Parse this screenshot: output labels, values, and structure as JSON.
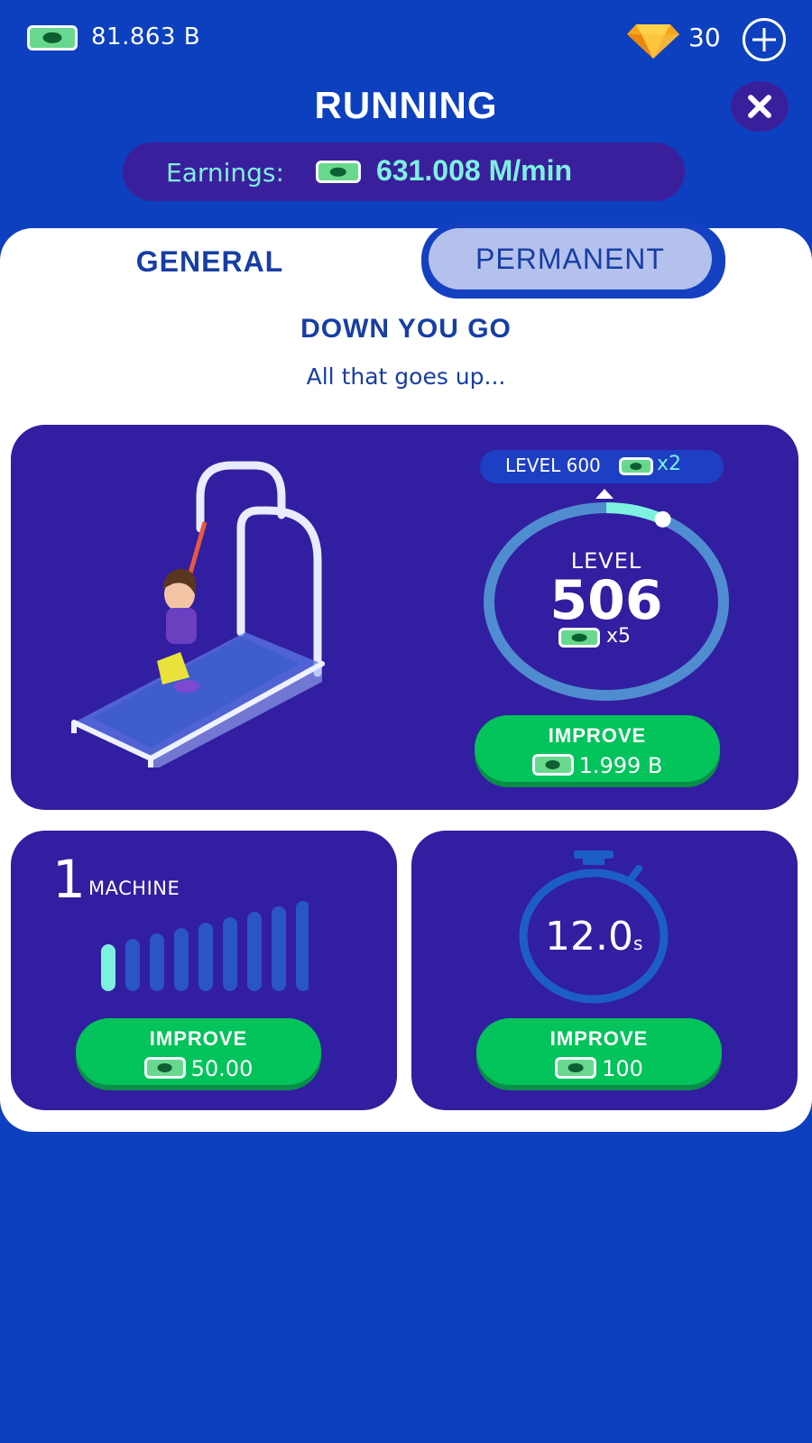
{
  "topbar": {
    "money": "81.863 B",
    "gems": "30",
    "money_icon": "cash-icon",
    "gem_icon": "diamond-icon",
    "plus_icon": "plus-icon"
  },
  "header": {
    "title": "RUNNING",
    "close_icon": "close-icon"
  },
  "earnings": {
    "label": "Earnings:",
    "value": "631.008 M/min"
  },
  "tabs": [
    {
      "label": "GENERAL",
      "active": true
    },
    {
      "label": "PERMANENT",
      "active": false
    }
  ],
  "upgrade": {
    "title": "DOWN YOU GO",
    "subtitle": "All that goes up..."
  },
  "level_card": {
    "next_milestone": "LEVEL 600",
    "next_multiplier": "x2",
    "level_label": "LEVEL",
    "level": "506",
    "multiplier": "x5",
    "progress": 0.08,
    "improve_label": "IMPROVE",
    "improve_cost": "1.999 B"
  },
  "machine_card": {
    "count": "1",
    "label": "MACHINE",
    "filled": 1,
    "total": 9,
    "improve_label": "IMPROVE",
    "improve_cost": "50.00"
  },
  "timer_card": {
    "value": "12.0",
    "unit": "s",
    "improve_label": "IMPROVE",
    "improve_cost": "100"
  },
  "colors": {
    "background": "#0c40bf",
    "card": "#321ea0",
    "accent": "#7ef0e0",
    "button": "#03c35b",
    "text_dark": "#173ea5"
  }
}
